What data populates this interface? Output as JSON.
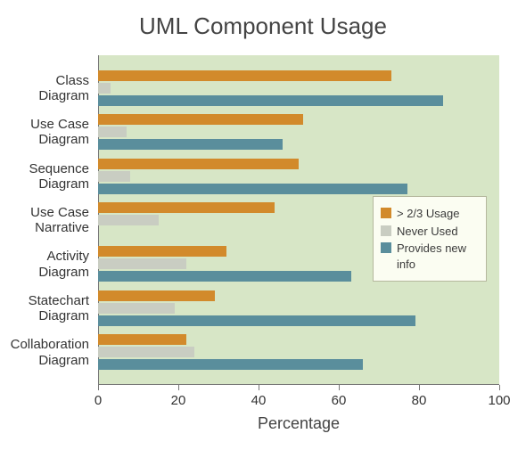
{
  "title": "UML Component Usage",
  "xlabel": "Percentage",
  "legend": {
    "usage": "> 2/3 Usage",
    "never": "Never Used",
    "info": "Provides new info"
  },
  "xticks": [
    0,
    20,
    40,
    60,
    80,
    100
  ],
  "categories": [
    "Class Diagram",
    "Use Case Diagram",
    "Sequence Diagram",
    "Use Case Narrative",
    "Activity Diagram",
    "Statechart Diagram",
    "Collaboration Diagram"
  ],
  "chart_data": {
    "type": "bar",
    "orientation": "horizontal",
    "xlabel": "Percentage",
    "xlim": [
      0,
      100
    ],
    "categories": [
      "Class Diagram",
      "Use Case Diagram",
      "Sequence Diagram",
      "Use Case Narrative",
      "Activity Diagram",
      "Statechart Diagram",
      "Collaboration Diagram"
    ],
    "series": [
      {
        "name": "> 2/3 Usage",
        "color": "#d28a2b",
        "values": [
          73,
          51,
          50,
          44,
          32,
          29,
          22
        ]
      },
      {
        "name": "Never Used",
        "color": "#c9cdc2",
        "values": [
          3,
          7,
          8,
          15,
          22,
          19,
          24
        ]
      },
      {
        "name": "Provides new info",
        "color": "#5a8e9c",
        "values": [
          86,
          46,
          77,
          0,
          63,
          79,
          66
        ]
      }
    ]
  }
}
